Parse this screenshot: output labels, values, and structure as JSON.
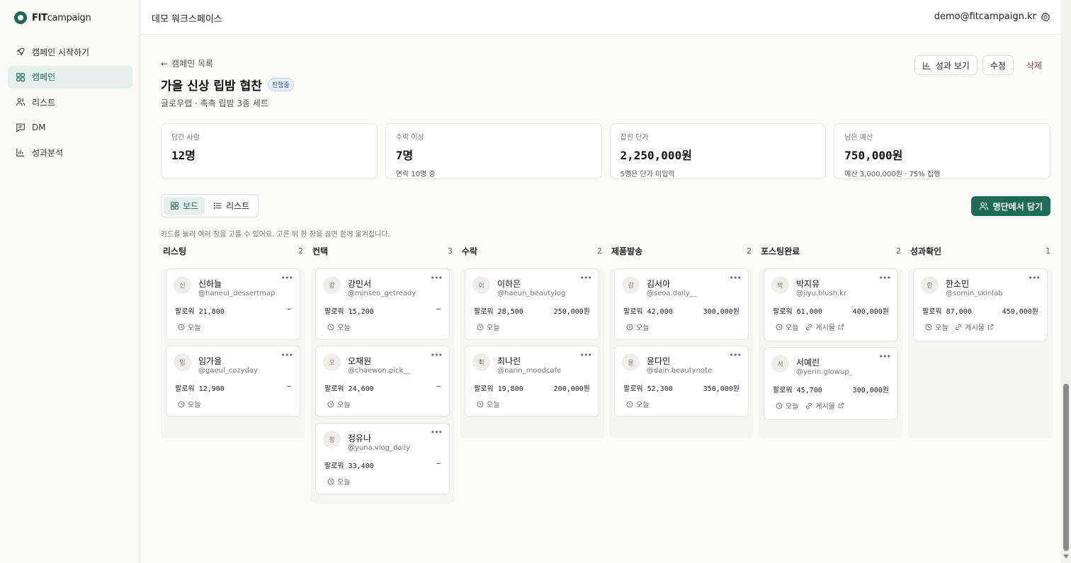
{
  "brand": {
    "bold": "FIT",
    "light": "campaign"
  },
  "sidebar": {
    "items": [
      {
        "label": "캠페인 시작하기",
        "icon": "rocket-icon"
      },
      {
        "label": "캠페인",
        "icon": "grid-icon"
      },
      {
        "label": "리스트",
        "icon": "users-icon"
      },
      {
        "label": "DM",
        "icon": "message-icon"
      },
      {
        "label": "성과분석",
        "icon": "chart-icon"
      }
    ]
  },
  "header": {
    "workspace": "데모 워크스페이스",
    "user": "demo@fitcampaign.kr"
  },
  "campaign": {
    "back": "캠페인 목록",
    "title": "가을 신상 립밤 협찬",
    "status": "진행중",
    "subtitle": "글로우랩 · 촉촉 립밤 3종 세트",
    "actions": {
      "report": "성과 보기",
      "edit": "수정",
      "delete": "삭제"
    }
  },
  "stats": [
    {
      "label": "담긴 사람",
      "value": "12명",
      "sub": ""
    },
    {
      "label": "수락 이상",
      "value": "7명",
      "sub": "연락 10명 중"
    },
    {
      "label": "잡힌 단가",
      "value": "2,250,000원",
      "sub": "5명은 단가 미입력"
    },
    {
      "label": "남은 예산",
      "value": "750,000원",
      "sub": "예산 3,000,000원 · 75% 집행"
    }
  ],
  "view": {
    "board": "보드",
    "list": "리스트",
    "add": "명단에서 담기",
    "hint": "카드를 눌러 여러 장을 고를 수 있어요. 고른 뒤 한 장을 끌면 함께 옮겨집니다."
  },
  "columns": [
    {
      "name": "리스팅",
      "count": "2",
      "cards": [
        {
          "avatar": "신",
          "name": "신하늘",
          "handle": "@haneul_dessertmap",
          "followers": "팔로워 21,800",
          "price": "–",
          "time": "오늘",
          "post": ""
        },
        {
          "avatar": "임",
          "name": "임가을",
          "handle": "@gaeul_cozyday",
          "followers": "팔로워 12,900",
          "price": "–",
          "time": "오늘",
          "post": ""
        }
      ]
    },
    {
      "name": "컨택",
      "count": "3",
      "cards": [
        {
          "avatar": "강",
          "name": "강민서",
          "handle": "@minseo_getready",
          "followers": "팔로워 15,200",
          "price": "–",
          "time": "오늘",
          "post": ""
        },
        {
          "avatar": "오",
          "name": "오채원",
          "handle": "@chaewon.pick__",
          "followers": "팔로워 24,600",
          "price": "–",
          "time": "오늘",
          "post": ""
        },
        {
          "avatar": "정",
          "name": "정유나",
          "handle": "@yuna.vlog_daily",
          "followers": "팔로워 33,400",
          "price": "–",
          "time": "오늘",
          "post": ""
        }
      ]
    },
    {
      "name": "수락",
      "count": "2",
      "cards": [
        {
          "avatar": "이",
          "name": "이하은",
          "handle": "@haeun_beautylog",
          "followers": "팔로워 28,500",
          "price": "250,000원",
          "time": "오늘",
          "post": ""
        },
        {
          "avatar": "최",
          "name": "최나린",
          "handle": "@narin_moodcafe",
          "followers": "팔로워 19,800",
          "price": "200,000원",
          "time": "오늘",
          "post": ""
        }
      ]
    },
    {
      "name": "제품발송",
      "count": "2",
      "cards": [
        {
          "avatar": "김",
          "name": "김서아",
          "handle": "@seoa.daily__",
          "followers": "팔로워 42,000",
          "price": "300,000원",
          "time": "오늘",
          "post": ""
        },
        {
          "avatar": "윤",
          "name": "윤다인",
          "handle": "@dain.beautynote",
          "followers": "팔로워 52,300",
          "price": "350,000원",
          "time": "오늘",
          "post": ""
        }
      ]
    },
    {
      "name": "포스팅완료",
      "count": "2",
      "cards": [
        {
          "avatar": "박",
          "name": "박지유",
          "handle": "@jiyu.blush.kr",
          "followers": "팔로워 61,000",
          "price": "400,000원",
          "time": "오늘",
          "post": "게시물"
        },
        {
          "avatar": "서",
          "name": "서예린",
          "handle": "@yerin.glowup_",
          "followers": "팔로워 45,700",
          "price": "300,000원",
          "time": "오늘",
          "post": "게시물"
        }
      ]
    },
    {
      "name": "성과확인",
      "count": "1",
      "cards": [
        {
          "avatar": "한",
          "name": "한소민",
          "handle": "@somin_skinlab",
          "followers": "팔로워 87,000",
          "price": "450,000원",
          "time": "오늘",
          "post": "게시물"
        }
      ]
    }
  ]
}
